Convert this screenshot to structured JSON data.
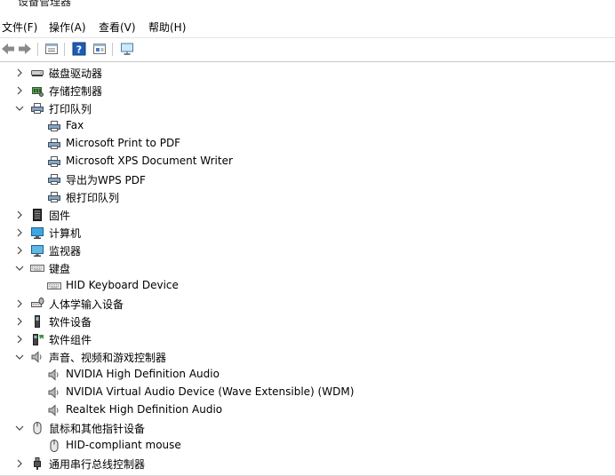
{
  "window": {
    "title": "设备管理器"
  },
  "menu": [
    "文件(F)",
    "操作(A)",
    "查看(V)",
    "帮助(H)"
  ],
  "toolbar": [
    {
      "icon": "back-arrow-icon"
    },
    {
      "icon": "forward-arrow-icon"
    },
    {
      "icon": "properties-icon"
    },
    {
      "icon": "help-icon"
    },
    {
      "icon": "view-panel-icon"
    },
    {
      "icon": "monitor-scan-icon"
    }
  ],
  "tree": [
    {
      "label": "磁盘驱动器",
      "level": 1,
      "expanded": false,
      "icon": "disk-drive-icon"
    },
    {
      "label": "存储控制器",
      "level": 1,
      "expanded": false,
      "icon": "storage-controller-icon"
    },
    {
      "label": "打印队列",
      "level": 1,
      "expanded": true,
      "icon": "printer-icon"
    },
    {
      "label": "Fax",
      "level": 2,
      "icon": "printer-icon"
    },
    {
      "label": "Microsoft Print to PDF",
      "level": 2,
      "icon": "printer-icon"
    },
    {
      "label": "Microsoft XPS Document Writer",
      "level": 2,
      "icon": "printer-icon"
    },
    {
      "label": "导出为WPS PDF",
      "level": 2,
      "icon": "printer-icon"
    },
    {
      "label": "根打印队列",
      "level": 2,
      "icon": "printer-icon"
    },
    {
      "label": "固件",
      "level": 1,
      "expanded": false,
      "icon": "firmware-icon"
    },
    {
      "label": "计算机",
      "level": 1,
      "expanded": false,
      "icon": "computer-icon"
    },
    {
      "label": "监视器",
      "level": 1,
      "expanded": false,
      "icon": "monitor-icon"
    },
    {
      "label": "键盘",
      "level": 1,
      "expanded": true,
      "icon": "keyboard-icon"
    },
    {
      "label": "HID Keyboard Device",
      "level": 2,
      "icon": "keyboard-icon"
    },
    {
      "label": "人体学输入设备",
      "level": 1,
      "expanded": false,
      "icon": "hid-icon"
    },
    {
      "label": "软件设备",
      "level": 1,
      "expanded": false,
      "icon": "software-device-icon"
    },
    {
      "label": "软件组件",
      "level": 1,
      "expanded": false,
      "icon": "software-component-icon"
    },
    {
      "label": "声音、视频和游戏控制器",
      "level": 1,
      "expanded": true,
      "icon": "speaker-icon"
    },
    {
      "label": "NVIDIA High Definition Audio",
      "level": 2,
      "icon": "speaker-icon"
    },
    {
      "label": "NVIDIA Virtual Audio Device (Wave Extensible) (WDM)",
      "level": 2,
      "icon": "speaker-icon"
    },
    {
      "label": "Realtek High Definition Audio",
      "level": 2,
      "icon": "speaker-icon"
    },
    {
      "label": "鼠标和其他指针设备",
      "level": 1,
      "expanded": true,
      "icon": "mouse-icon"
    },
    {
      "label": "HID-compliant mouse",
      "level": 2,
      "icon": "mouse-icon"
    },
    {
      "label": "通用串行总线控制器",
      "level": 1,
      "expanded": false,
      "icon": "usb-icon"
    }
  ]
}
